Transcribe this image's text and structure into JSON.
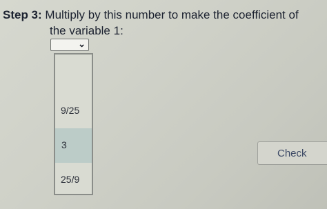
{
  "instruction": {
    "step_label": "Step 3:",
    "text_line1": "Multiply by this number to make the coefficient of",
    "text_line2": "the variable 1:"
  },
  "select": {
    "current_value": "",
    "icon": "chevron-down-icon"
  },
  "dropdown": {
    "options": [
      "9/25",
      "3",
      "25/9"
    ],
    "highlighted_index": 1
  },
  "check_button": {
    "label": "Check"
  }
}
